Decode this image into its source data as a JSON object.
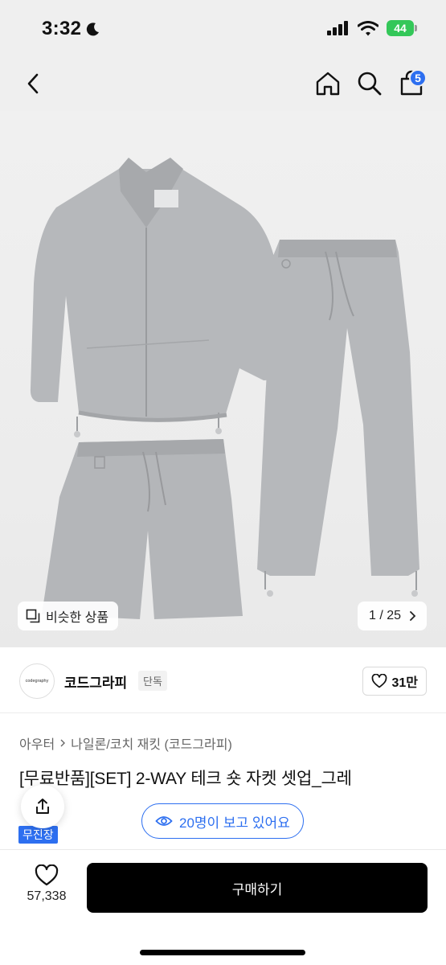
{
  "status_bar": {
    "time": "3:32",
    "battery": "44"
  },
  "nav": {
    "cart_count": "5"
  },
  "gallery": {
    "similar_label": "비슷한 상품",
    "page_indicator": "1 / 25"
  },
  "brand": {
    "logo_text": "codegraphy",
    "name": "코드그라피",
    "tag": "단독",
    "like_count": "31만"
  },
  "product": {
    "category_parent": "아우터",
    "category_child": "나일론/코치 재킷 (코드그라피)",
    "title": "[무료반품][SET] 2-WAY 테크 숏 자켓 셋업_그레",
    "badge": "무진장",
    "viewers": "20명이 보고 있어요"
  },
  "bottom_bar": {
    "wish_count": "57,338",
    "buy_label": "구매하기"
  },
  "colors": {
    "accent": "#2d6ff0",
    "garment": "#b4b6b9",
    "buy_button": "#000000"
  }
}
